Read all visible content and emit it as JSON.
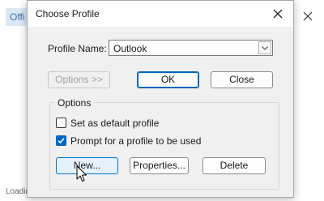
{
  "background": {
    "tab_label": "Offi",
    "loading_text": "Loading"
  },
  "dialog": {
    "title": "Choose Profile",
    "profile_label": "Profile Name:",
    "profile_value": "Outlook",
    "buttons": {
      "options": "Options >>",
      "ok": "OK",
      "close": "Close"
    },
    "options_group": {
      "label": "Options",
      "default_profile": {
        "label": "Set as default profile",
        "checked": false
      },
      "prompt_profile": {
        "label": "Prompt for a profile to be used",
        "checked": true
      },
      "buttons": {
        "new": "New...",
        "properties": "Properties...",
        "delete": "Delete"
      }
    }
  },
  "colors": {
    "accent": "#0067c0",
    "dialog_bg": "#f0f0f0",
    "tab_bg": "#dce8f5"
  },
  "icons": {
    "window_close": "close-icon",
    "combo_arrow": "chevron-down-icon",
    "checkmark": "check-icon",
    "cursor": "mouse-pointer-icon"
  }
}
